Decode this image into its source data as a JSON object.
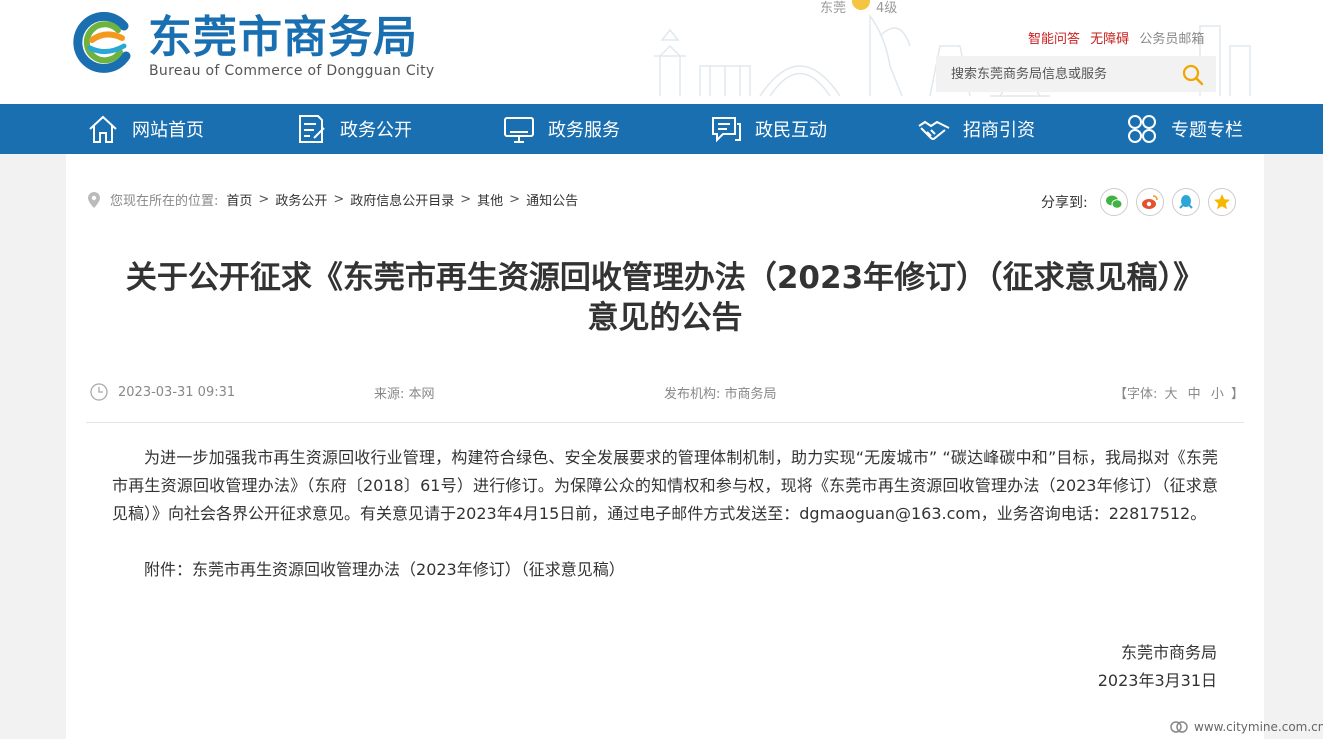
{
  "header": {
    "logo_cn": "东莞市商务局",
    "logo_en": "Bureau of  Commerce of Dongguan City",
    "weather": {
      "city": "东莞",
      "wind": "4级"
    },
    "toplinks": [
      "智能问答",
      "无障碍",
      "公务员邮箱"
    ],
    "search_placeholder": "搜索东莞商务局信息或服务"
  },
  "nav": {
    "items": [
      {
        "label": "网站首页",
        "icon": "home-icon"
      },
      {
        "label": "政务公开",
        "icon": "document-icon"
      },
      {
        "label": "政务服务",
        "icon": "monitor-icon"
      },
      {
        "label": "政民互动",
        "icon": "chat-icon"
      },
      {
        "label": "招商引资",
        "icon": "handshake-icon"
      },
      {
        "label": "专题专栏",
        "icon": "grid-icon"
      }
    ]
  },
  "breadcrumb": {
    "label": "您现在所在的位置:",
    "items": [
      "首页",
      "政务公开",
      "政府信息公开目录",
      "其他",
      "通知公告"
    ]
  },
  "share": {
    "label": "分享到:",
    "targets": [
      "wechat",
      "weibo",
      "qq",
      "favorite"
    ]
  },
  "article": {
    "title_line1": "关于公开征求《东莞市再生资源回收管理办法（2023年修订）（征求意见稿）》",
    "title_line2": "意见的公告",
    "date": "2023-03-31 09:31",
    "source_label": "来源:",
    "source": "本网",
    "org_label": "发布机构:",
    "org": "市商务局",
    "font_label": "【字体:",
    "font_sizes": [
      "大",
      "中",
      "小"
    ],
    "font_close": "】",
    "body": "为进一步加强我市再生资源回收行业管理，构建符合绿色、安全发展要求的管理体制机制，助力实现“无废城市” “碳达峰碳中和”目标，我局拟对《东莞市再生资源回收管理办法》（东府〔2018〕61号）进行修订。为保障公众的知情权和参与权，现将《东莞市再生资源回收管理办法（2023年修订）（征求意见稿）》向社会各界公开征求意见。有关意见请于2023年4月15日前，通过电子邮件方式发送至：dgmaoguan@163.com，业务咨询电话：22817512。",
    "attach_label": "附件：",
    "attach_link": "东莞市再生资源回收管理办法（2023年修订）（征求意见稿）",
    "sign_org": "东莞市商务局",
    "sign_date": "2023年3月31日"
  },
  "watermark": "www.citymine.com.cn",
  "colors": {
    "brand_blue": "#1a6fb0",
    "link_red": "#c81e1e",
    "logo_green": "#6cb33f",
    "logo_orange": "#f39a1e"
  }
}
